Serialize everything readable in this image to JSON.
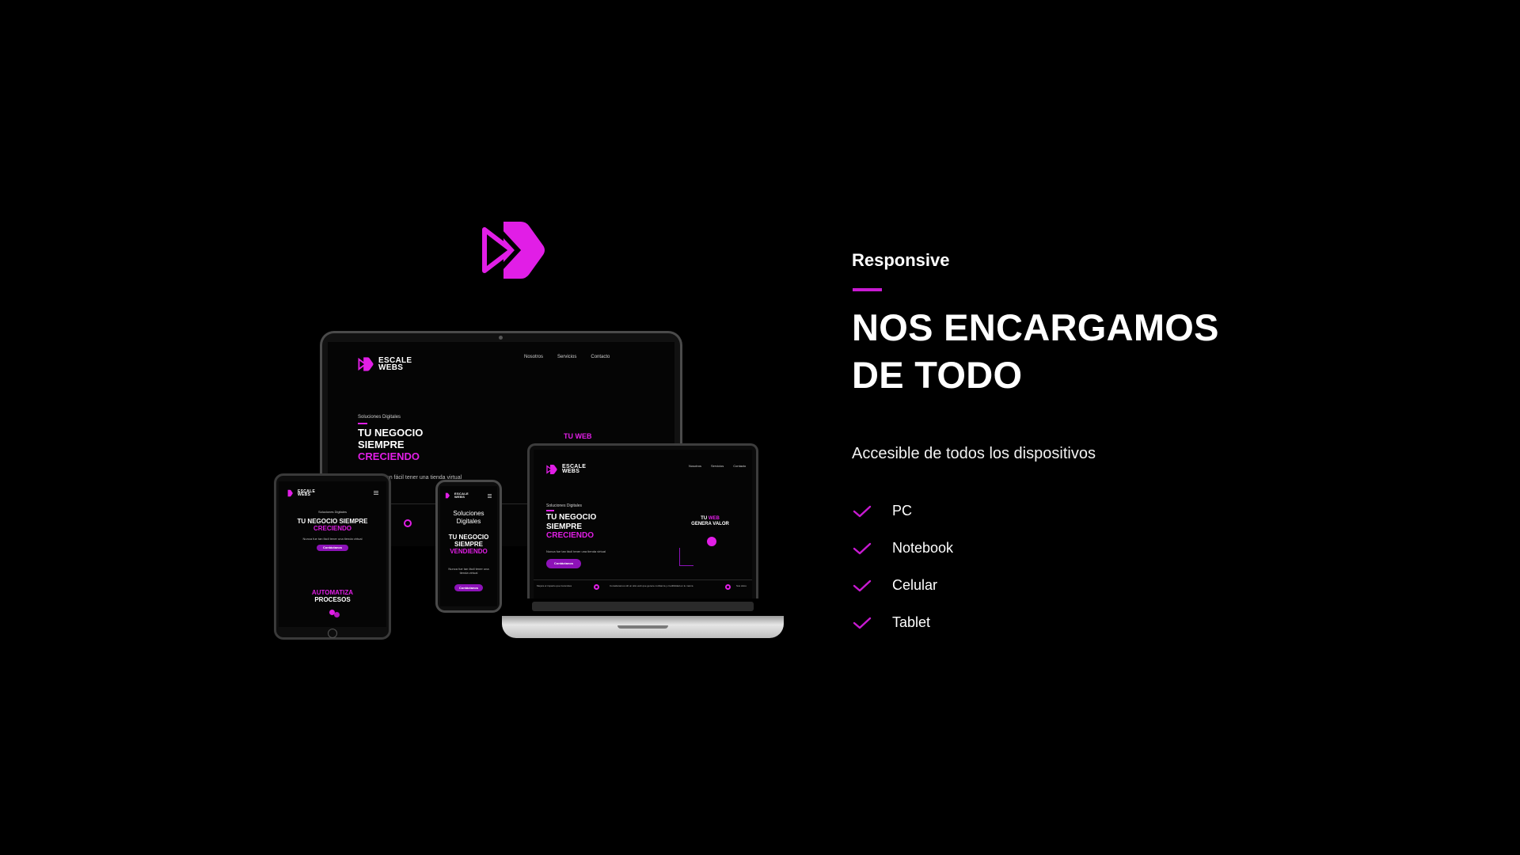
{
  "brand": {
    "accent_color": "#e11ee6",
    "logo_icon": "play-chevron-logo-icon",
    "name_line1": "ESCALE",
    "name_line2": "WEBS"
  },
  "section": {
    "kicker": "Responsive",
    "headline_line1": "NOS ENCARGAMOS",
    "headline_line2": "DE TODO",
    "subtitle": "Accesible de todos los dispositivos",
    "check_icon": "check-icon",
    "features": [
      "PC",
      "Notebook",
      "Celular",
      "Tablet"
    ]
  },
  "mockups": {
    "monitor": {
      "nav": [
        "Nosotros",
        "Servicios",
        "Contacto"
      ],
      "kicker": "Soluciones Digitales",
      "head1": "TU NEGOCIO",
      "head2": "SIEMPRE",
      "head3": "CRECIENDO",
      "sub": "Nunca fue tan fácil tener una tienda virtual",
      "side": "TU WEB"
    },
    "laptop": {
      "nav": [
        "Nosotros",
        "Servicios",
        "Contacto"
      ],
      "kicker": "Soluciones Digitales",
      "head1": "TU NEGOCIO",
      "head2": "SIEMPRE",
      "head3": "CRECIENDO",
      "sub": "Nunca fue tan fácil tener una tienda virtual",
      "cta": "Contáctanos",
      "side1": "TU",
      "side2": "WEB",
      "side3": "GENERA VALOR",
      "footer1": "Mejora el impacto que transmites",
      "footer2": "Consideramos útil un sitio web que genere confianza y credibilidad en tu marca",
      "footer3": "Sus sitios"
    },
    "tablet": {
      "kicker": "Soluciones Digitales",
      "head1": "TU NEGOCIO SIEMPRE",
      "head2": "CRECIENDO",
      "sub": "Nunca fue tan fácil tener una tienda virtual",
      "cta": "Contáctanos",
      "promo1": "AUTOMATIZA",
      "promo2": "PROCESOS"
    },
    "phone": {
      "kicker1": "Soluciones",
      "kicker2": "Digitales",
      "head1": "TU NEGOCIO",
      "head2": "SIEMPRE",
      "head3": "VENDIENDO",
      "sub": "Nunca fue tan fácil tener una tienda virtual",
      "cta": "Contáctanos"
    }
  }
}
